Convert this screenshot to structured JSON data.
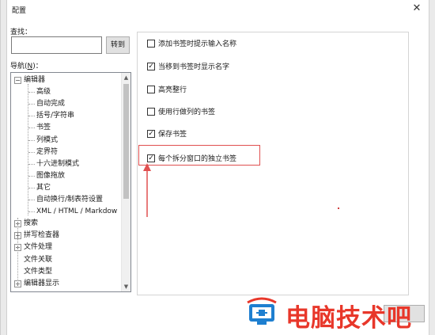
{
  "window": {
    "title": "配置",
    "close_glyph": "✕"
  },
  "find": {
    "label": "查找：",
    "value": "",
    "goto_label": "转到"
  },
  "nav": {
    "label_prefix": "导航(",
    "accel": "N",
    "label_suffix": ")："
  },
  "tree": {
    "items": [
      {
        "label": "编辑器",
        "level": 0,
        "expander": "−"
      },
      {
        "label": "高级",
        "level": 1
      },
      {
        "label": "自动完成",
        "level": 1
      },
      {
        "label": "括号/字符串",
        "level": 1
      },
      {
        "label": "书签",
        "level": 1
      },
      {
        "label": "列模式",
        "level": 1
      },
      {
        "label": "定界符",
        "level": 1
      },
      {
        "label": "十六进制模式",
        "level": 1
      },
      {
        "label": "图像拖放",
        "level": 1
      },
      {
        "label": "其它",
        "level": 1
      },
      {
        "label": "自动换行/制表符设置",
        "level": 1
      },
      {
        "label": "XML / HTML / Markdow",
        "level": 1
      },
      {
        "label": "搜索",
        "level": 0,
        "expander": "+"
      },
      {
        "label": "拼写检查器",
        "level": 0,
        "expander": "+"
      },
      {
        "label": "文件处理",
        "level": 0,
        "expander": "+"
      },
      {
        "label": "文件关联",
        "level": 0
      },
      {
        "label": "文件类型",
        "level": 0
      },
      {
        "label": "编辑器显示",
        "level": 0,
        "expander": "+"
      }
    ]
  },
  "options": [
    {
      "label": "添加书签时提示输入名称",
      "checked": false
    },
    {
      "label": "当移到书签时显示名字",
      "checked": true
    },
    {
      "label": "高亮整行",
      "checked": false
    },
    {
      "label": "使用行做列的书签",
      "checked": false
    },
    {
      "label": "保存书签",
      "checked": true
    },
    {
      "label": "每个拆分窗口的独立书签",
      "checked": true
    }
  ],
  "watermark": {
    "text": "电脑技术吧"
  },
  "colors": {
    "highlight": "#e05050",
    "watermark": "#e8372a",
    "logo_blue": "#1e7fd0"
  }
}
